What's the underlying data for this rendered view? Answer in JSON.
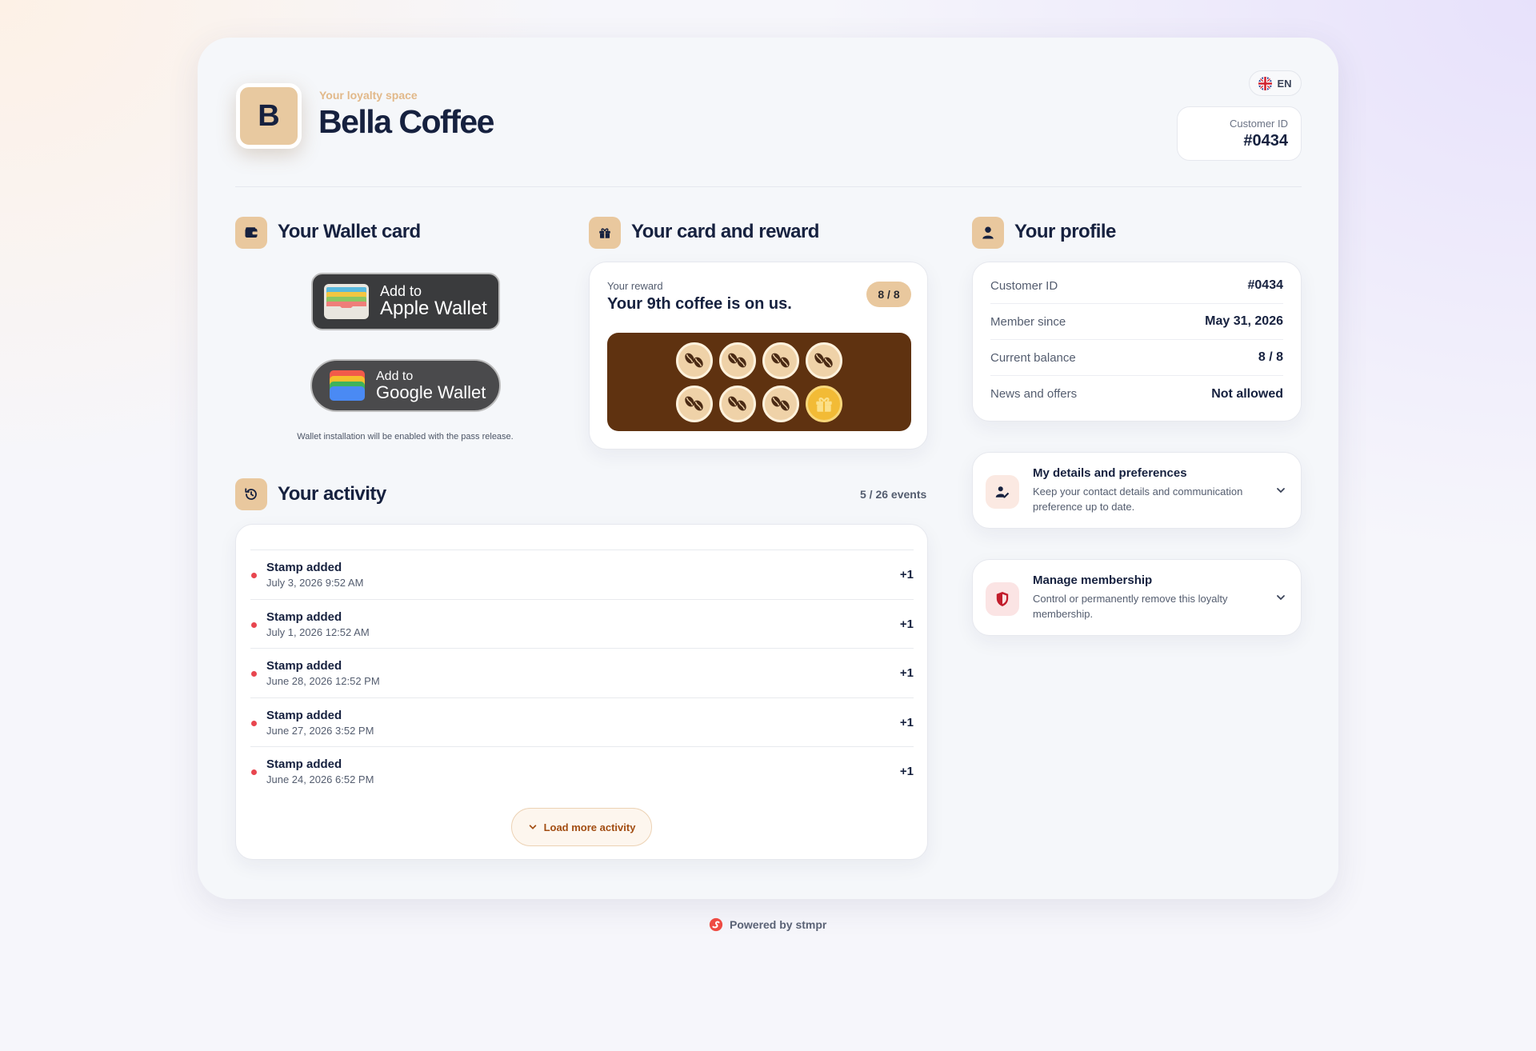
{
  "header": {
    "logo_letter": "B",
    "subtitle": "Your loyalty space",
    "title": "Bella Coffee",
    "language": "EN",
    "customer_id_label": "Customer ID",
    "customer_id_value": "#0434"
  },
  "wallet": {
    "title": "Your Wallet card",
    "apple_line1": "Add to",
    "apple_line2": "Apple Wallet",
    "google_line1": "Add to",
    "google_line2": "Google Wallet",
    "note": "Wallet installation will be enabled with the pass release."
  },
  "reward": {
    "section_title": "Your card and reward",
    "label": "Your reward",
    "title": "Your 9th coffee is on us.",
    "progress": "8 / 8",
    "stamps_collected": 7,
    "stamps_total": 8
  },
  "profile": {
    "title": "Your profile",
    "rows": [
      {
        "label": "Customer ID",
        "value": "#0434"
      },
      {
        "label": "Member since",
        "value": "May 31, 2026"
      },
      {
        "label": "Current balance",
        "value": "8 / 8"
      },
      {
        "label": "News and offers",
        "value": "Not allowed"
      }
    ],
    "details": {
      "title": "My details and preferences",
      "description": "Keep your contact details and communication preference up to date."
    },
    "membership": {
      "title": "Manage membership",
      "description": "Control or permanently remove this loyalty membership."
    }
  },
  "activity": {
    "title": "Your activity",
    "count": "5 / 26 events",
    "items": [
      {
        "title": "Stamp added",
        "date": "July 3, 2026 9:52 AM",
        "points": "+1"
      },
      {
        "title": "Stamp added",
        "date": "July 1, 2026 12:52 AM",
        "points": "+1"
      },
      {
        "title": "Stamp added",
        "date": "June 28, 2026 12:52 PM",
        "points": "+1"
      },
      {
        "title": "Stamp added",
        "date": "June 27, 2026 3:52 PM",
        "points": "+1"
      },
      {
        "title": "Stamp added",
        "date": "June 24, 2026 6:52 PM",
        "points": "+1"
      }
    ],
    "load_more": "Load more activity"
  },
  "footer": {
    "powered_by": "Powered by stmpr"
  },
  "colors": {
    "accent": "#e9c89e",
    "navy": "#16213f",
    "stamp_board": "#5f3210",
    "activity_dot": "#e8464f",
    "load_more_text": "#a24d12"
  }
}
